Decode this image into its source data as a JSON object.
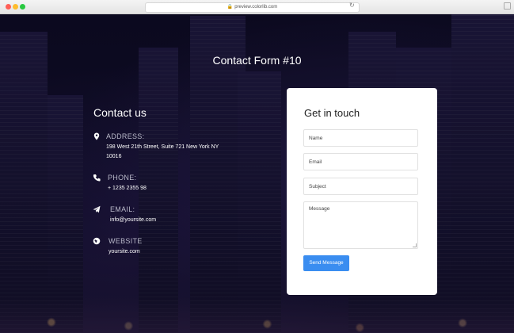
{
  "browser": {
    "url": "preview.colorlib.com"
  },
  "page": {
    "title": "Contact Form #10"
  },
  "contact": {
    "heading": "Contact us",
    "items": [
      {
        "icon": "map-pin-icon",
        "label": "ADDRESS:",
        "value_line1": "198 West 21th Street, Suite 721 New York NY",
        "value_line2": "10016"
      },
      {
        "icon": "phone-icon",
        "label": "PHONE:",
        "value_line1": "+ 1235 2355 98"
      },
      {
        "icon": "paper-plane-icon",
        "label": "EMAIL:",
        "value_line1": "info@yoursite.com"
      },
      {
        "icon": "globe-icon",
        "label": "WEBSITE",
        "value_line1": "yoursite.com"
      }
    ]
  },
  "form": {
    "heading": "Get in touch",
    "name_placeholder": "Name",
    "email_placeholder": "Email",
    "subject_placeholder": "Subject",
    "message_placeholder": "Message",
    "submit_label": "Send Message"
  },
  "colors": {
    "accent": "#3a8df0",
    "card": "#ffffff",
    "background": "#0f0c25"
  }
}
